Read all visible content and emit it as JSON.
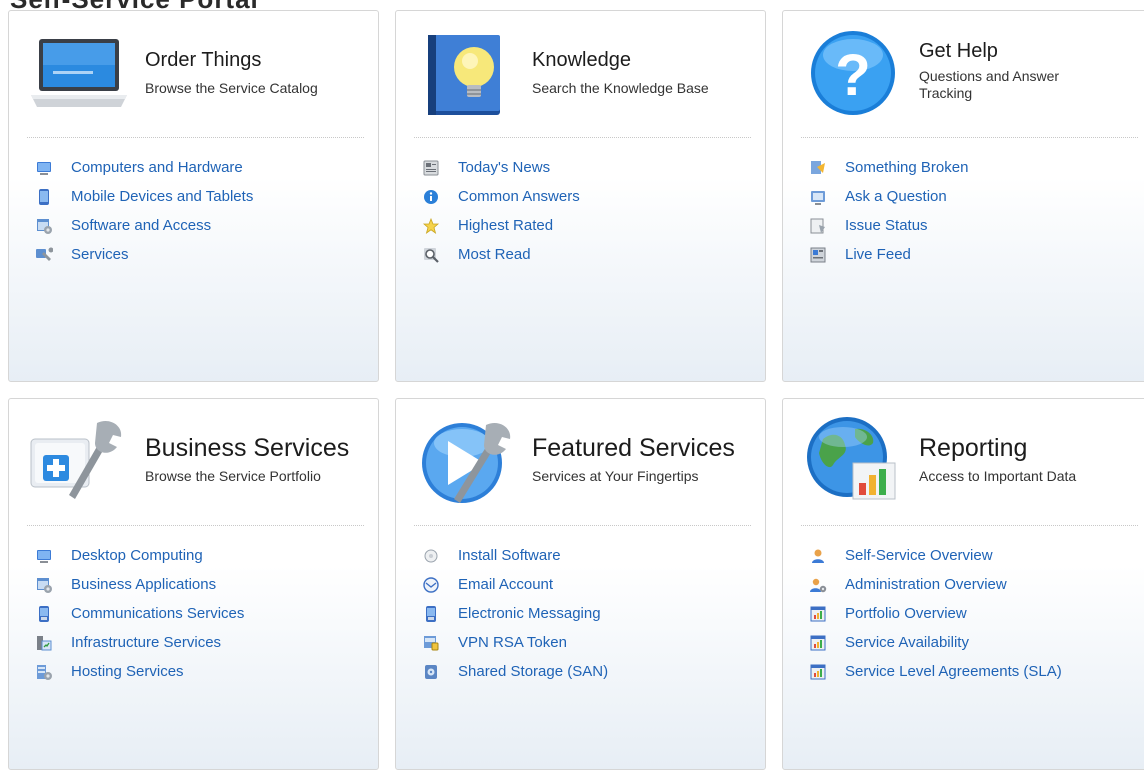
{
  "page_heading": "Self-Service Portal",
  "cards": [
    {
      "title": "Order Things",
      "subtitle": "Browse the Service Catalog",
      "links": [
        "Computers and Hardware",
        "Mobile Devices and Tablets",
        "Software and Access",
        "Services"
      ]
    },
    {
      "title": "Knowledge",
      "subtitle": "Search the Knowledge Base",
      "links": [
        "Today's News",
        "Common Answers",
        "Highest Rated",
        "Most Read"
      ]
    },
    {
      "title": "Get Help",
      "subtitle": "Questions and Answer Tracking",
      "links": [
        "Something Broken",
        "Ask a Question",
        "Issue Status",
        "Live Feed"
      ]
    },
    {
      "title": "Business Services",
      "subtitle": "Browse the Service Portfolio",
      "links": [
        "Desktop Computing",
        "Business Applications",
        "Communications Services",
        "Infrastructure Services",
        "Hosting Services"
      ]
    },
    {
      "title": "Featured Services",
      "subtitle": "Services at Your Fingertips",
      "links": [
        "Install Software",
        "Email Account",
        "Electronic Messaging",
        "VPN RSA Token",
        "Shared Storage (SAN)"
      ]
    },
    {
      "title": "Reporting",
      "subtitle": "Access to Important Data",
      "links": [
        "Self-Service Overview",
        "Administration Overview",
        "Portfolio Overview",
        "Service Availability",
        "Service Level Agreements (SLA)"
      ]
    }
  ],
  "colors": {
    "link": "#1f63b6",
    "title": "#1c1c1c",
    "card_border": "#d6d6d6"
  }
}
